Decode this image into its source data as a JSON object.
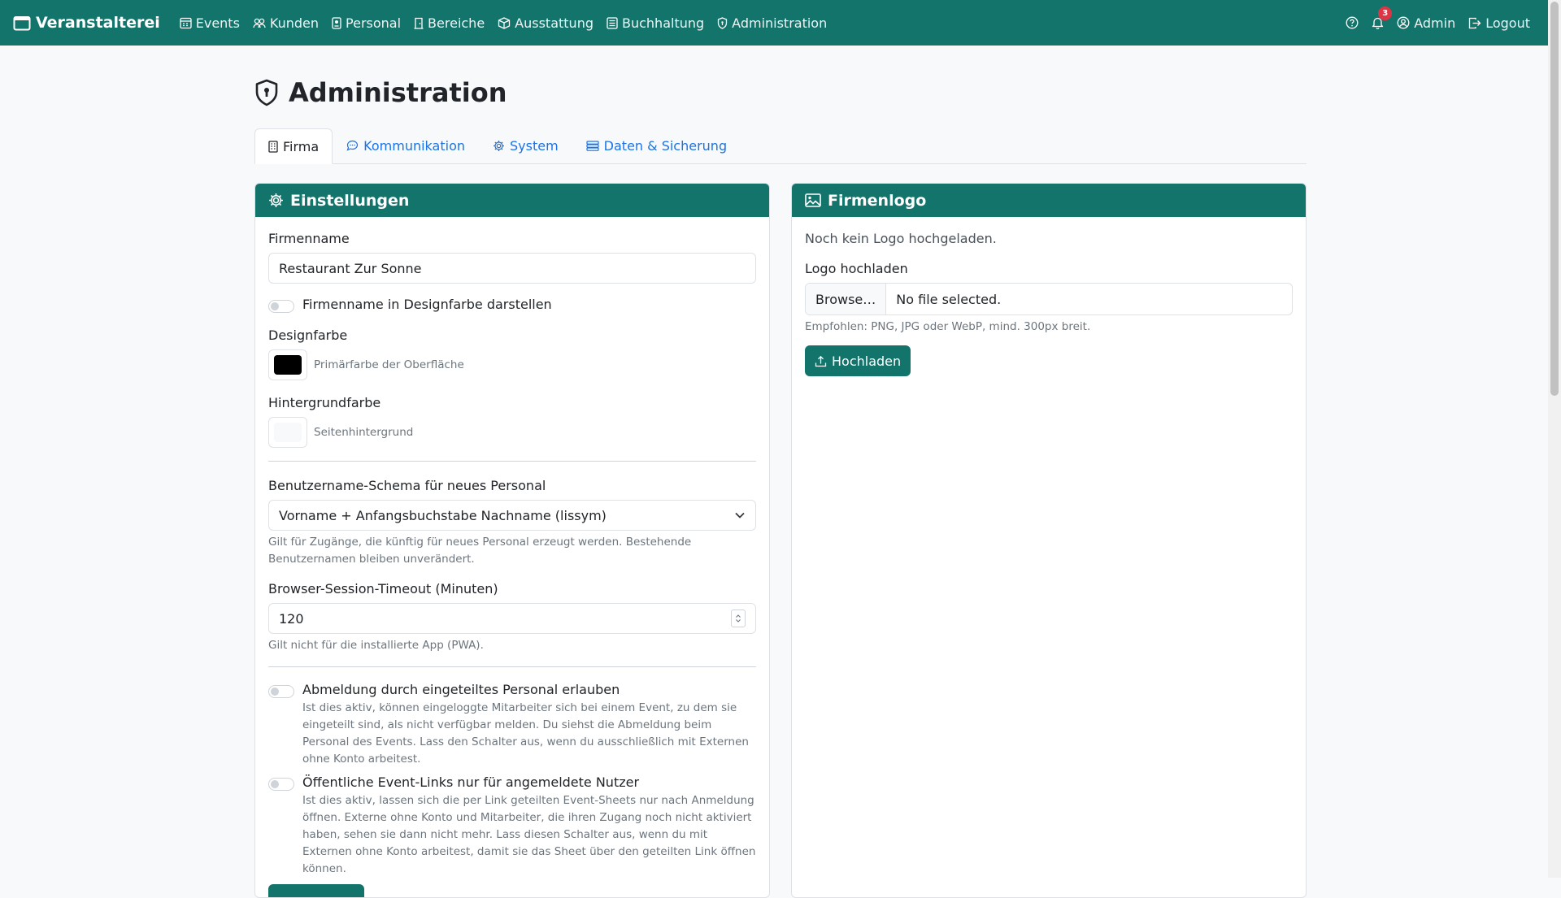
{
  "brand": {
    "name": "Veranstalterei",
    "icon": "calendar-icon"
  },
  "nav": {
    "items": [
      {
        "label": "Events",
        "icon": "calendar-grid-icon"
      },
      {
        "label": "Kunden",
        "icon": "people-icon"
      },
      {
        "label": "Personal",
        "icon": "badge-icon"
      },
      {
        "label": "Bereiche",
        "icon": "door-icon"
      },
      {
        "label": "Ausstattung",
        "icon": "box-icon"
      },
      {
        "label": "Buchhaltung",
        "icon": "ledger-icon"
      },
      {
        "label": "Administration",
        "icon": "shield-icon"
      }
    ],
    "notification_count": "3",
    "user_label": "Admin",
    "logout_label": "Logout"
  },
  "page": {
    "title": "Administration"
  },
  "tabs": [
    {
      "label": "Firma",
      "active": true
    },
    {
      "label": "Kommunikation",
      "active": false
    },
    {
      "label": "System",
      "active": false
    },
    {
      "label": "Daten & Sicherung",
      "active": false
    }
  ],
  "settings": {
    "header": "Einstellungen",
    "company_name_label": "Firmenname",
    "company_name_value": "Restaurant Zur Sonne",
    "company_name_color_toggle": "Firmenname in Designfarbe darstellen",
    "design_color_label": "Designfarbe",
    "design_color_value": "#000000",
    "design_color_help": "Primärfarbe der Oberfläche",
    "background_color_label": "Hintergrundfarbe",
    "background_color_value": "#f8f9fa",
    "background_color_help": "Seitenhintergrund",
    "username_schema_label": "Benutzername-Schema für neues Personal",
    "username_schema_value": "Vorname + Anfangsbuchstabe Nachname (lissym)",
    "username_schema_help": "Gilt für Zugänge, die künftig für neues Personal erzeugt werden. Bestehende Benutzernamen bleiben unverändert.",
    "session_timeout_label": "Browser-Session-Timeout (Minuten)",
    "session_timeout_value": "120",
    "session_timeout_help": "Gilt nicht für die installierte App (PWA).",
    "staff_signoff_label": "Abmeldung durch eingeteiltes Personal erlauben",
    "staff_signoff_help": "Ist dies aktiv, können eingeloggte Mitarbeiter sich bei einem Event, zu dem sie eingeteilt sind, als nicht verfügbar melden. Du siehst die Abmeldung beim Personal des Events. Lass den Schalter aus, wenn du ausschließlich mit Externen ohne Konto arbeitest.",
    "public_links_label": "Öffentliche Event-Links nur für angemeldete Nutzer",
    "public_links_help": "Ist dies aktiv, lassen sich die per Link geteilten Event-Sheets nur nach Anmeldung öffnen. Externe ohne Konto und Mitarbeiter, die ihren Zugang noch nicht aktiviert haben, sehen sie dann nicht mehr. Lass diesen Schalter aus, wenn du mit Externen ohne Konto arbeitest, damit sie das Sheet über den geteilten Link öffnen können."
  },
  "logo": {
    "header": "Firmenlogo",
    "status": "Noch kein Logo hochgeladen.",
    "upload_label": "Logo hochladen",
    "browse_label": "Browse…",
    "file_placeholder": "No file selected.",
    "help": "Empfohlen: PNG, JPG oder WebP, mind. 300px breit.",
    "upload_button": "Hochladen"
  },
  "colors": {
    "accent": "#13746c",
    "link": "#1a73e8",
    "badge": "#dc3545"
  }
}
